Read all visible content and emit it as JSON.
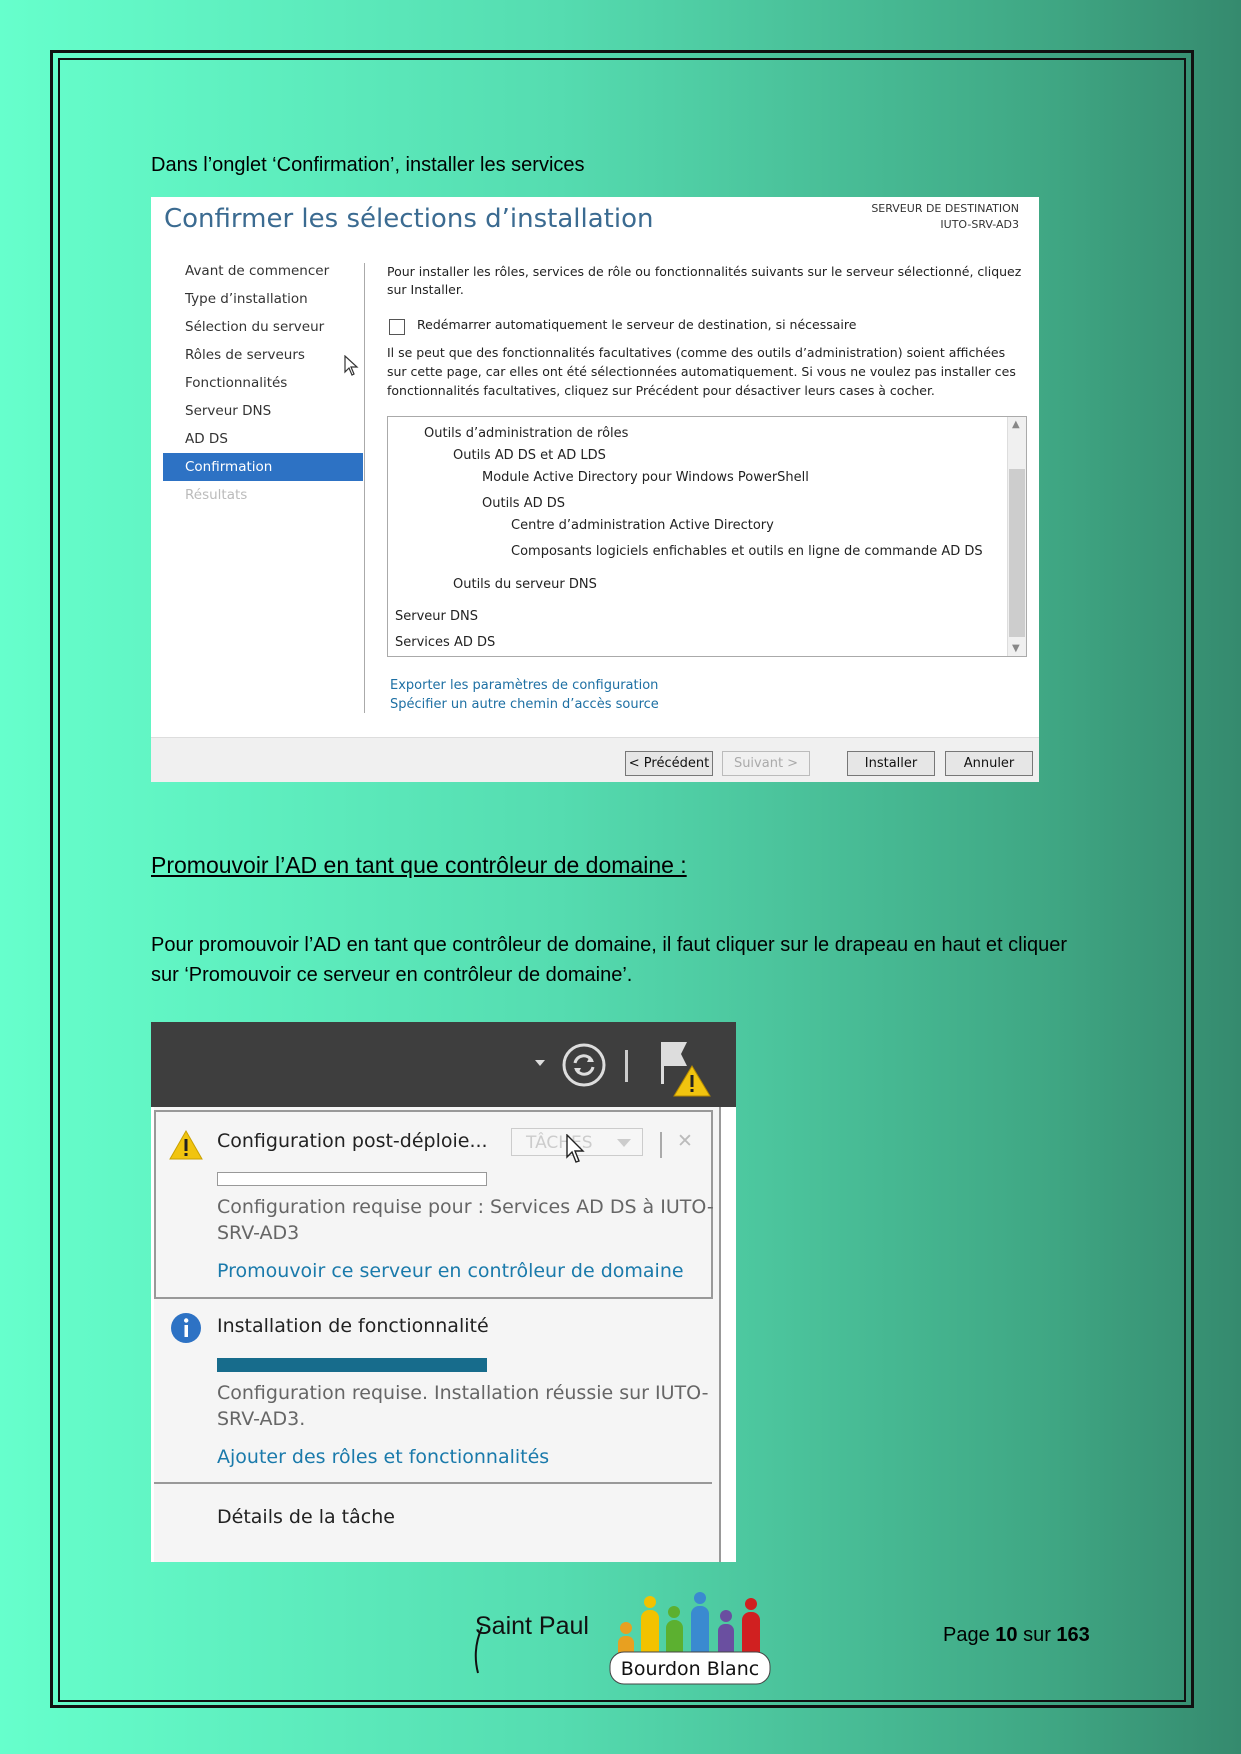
{
  "instruction_1": "Dans l’onglet ‘Confirmation’, installer les services",
  "wizard": {
    "title": "Confirmer les sélections d’installation",
    "dest_label": "SERVEUR DE DESTINATION",
    "dest_server": "IUTO-SRV-AD3",
    "nav": [
      "Avant de commencer",
      "Type d’installation",
      "Sélection du serveur",
      "Rôles de serveurs",
      "Fonctionnalités",
      "Serveur DNS",
      "AD DS",
      "Confirmation",
      "Résultats"
    ],
    "active_nav": "Confirmation",
    "intro": "Pour installer les rôles, services de rôle ou fonctionnalités suivants sur le serveur sélectionné, cliquez sur Installer.",
    "restart_label": "Redémarrer automatiquement le serveur de destination, si nécessaire",
    "note": "Il se peut que des fonctionnalités facultatives (comme des outils d’administration) soient affichées sur cette page, car elles ont été sélectionnées automatiquement. Si vous ne voulez pas installer ces fonctionnalités facultatives, cliquez sur Précédent pour désactiver leurs cases à cocher.",
    "list": [
      "Outils d’administration de rôles",
      "Outils AD DS et AD LDS",
      "Module Active Directory pour Windows PowerShell",
      "Outils AD DS",
      "Centre d’administration Active Directory",
      "Composants logiciels enfichables et outils en ligne de commande AD DS",
      "Outils du serveur DNS",
      "Serveur DNS",
      "Services AD DS"
    ],
    "link_export": "Exporter les paramètres de configuration",
    "link_source": "Spécifier un autre chemin d’accès source",
    "btn_prev": "< Précédent",
    "btn_next": "Suivant >",
    "btn_install": "Installer",
    "btn_cancel": "Annuler"
  },
  "heading": "Promouvoir l’AD en tant que contrôleur de domaine :",
  "instruction_2": "Pour promouvoir l’AD en tant que contrôleur de domaine, il faut cliquer sur le drapeau en haut et cliquer sur ‘Promouvoir ce serveur en contrôleur de domaine’.",
  "notifications": {
    "item1_title": "Configuration post-déploie...",
    "tasks_label": "TÂCHES",
    "item1_desc_1": "Configuration requise pour : Services AD DS à IUTO-",
    "item1_desc_2": "SRV-AD3",
    "item1_link": "Promouvoir ce serveur en contrôleur de domaine",
    "item2_title": "Installation de fonctionnalité",
    "item2_desc_1": "Configuration requise. Installation réussie sur IUTO-",
    "item2_desc_2": "SRV-AD3.",
    "item2_link": "Ajouter des rôles et fonctionnalités",
    "details": "Détails de la tâche",
    "item2_progress": 1.0,
    "item1_progress": 0.0
  },
  "footer": {
    "brand_text": "Saint Paul",
    "logo_text": "Bourdon Blanc",
    "page_prefix": "Page ",
    "page_current": "10",
    "page_mid": " sur ",
    "page_total": "163"
  }
}
